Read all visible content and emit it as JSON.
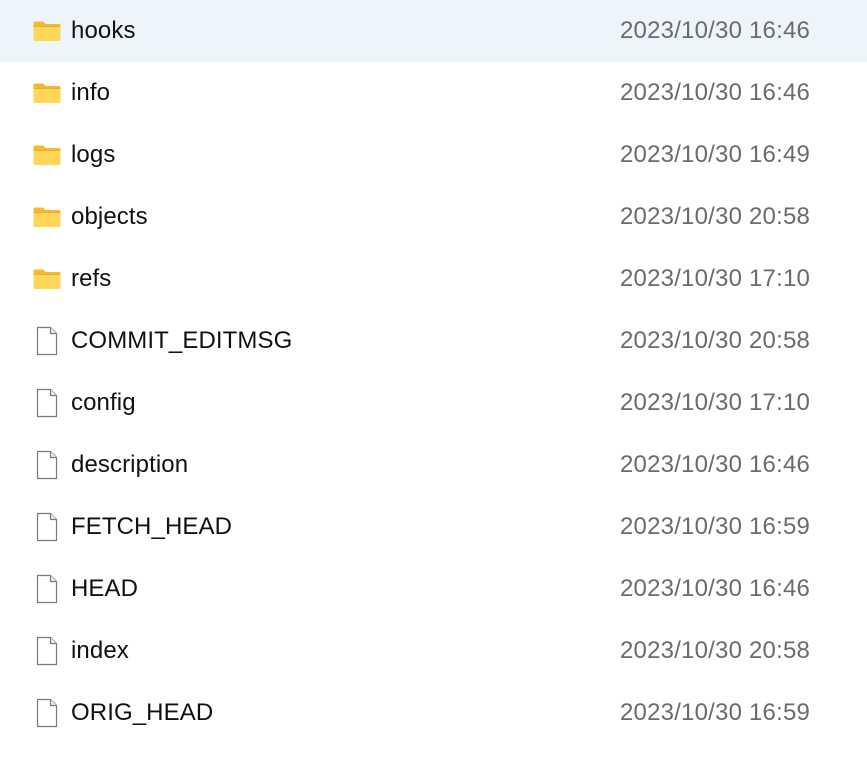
{
  "entries": [
    {
      "name": "hooks",
      "type": "folder",
      "icon": "folder-icon",
      "modified": "2023/10/30 16:46"
    },
    {
      "name": "info",
      "type": "folder",
      "icon": "folder-icon",
      "modified": "2023/10/30 16:46"
    },
    {
      "name": "logs",
      "type": "folder",
      "icon": "folder-icon",
      "modified": "2023/10/30 16:49"
    },
    {
      "name": "objects",
      "type": "folder",
      "icon": "folder-icon",
      "modified": "2023/10/30 20:58"
    },
    {
      "name": "refs",
      "type": "folder",
      "icon": "folder-icon",
      "modified": "2023/10/30 17:10"
    },
    {
      "name": "COMMIT_EDITMSG",
      "type": "file",
      "icon": "file-icon",
      "modified": "2023/10/30 20:58"
    },
    {
      "name": "config",
      "type": "file",
      "icon": "file-icon",
      "modified": "2023/10/30 17:10"
    },
    {
      "name": "description",
      "type": "file",
      "icon": "file-icon",
      "modified": "2023/10/30 16:46"
    },
    {
      "name": "FETCH_HEAD",
      "type": "file",
      "icon": "file-icon",
      "modified": "2023/10/30 16:59"
    },
    {
      "name": "HEAD",
      "type": "file",
      "icon": "file-icon",
      "modified": "2023/10/30 16:46"
    },
    {
      "name": "index",
      "type": "file",
      "icon": "file-icon",
      "modified": "2023/10/30 20:58"
    },
    {
      "name": "ORIG_HEAD",
      "type": "file",
      "icon": "file-icon",
      "modified": "2023/10/30 16:59"
    }
  ],
  "colors": {
    "folder_front": "#ffd658",
    "folder_back": "#f4b92e",
    "file_outline": "#7a7a7a",
    "name_text": "#111111",
    "date_text": "#6b6b6b"
  }
}
